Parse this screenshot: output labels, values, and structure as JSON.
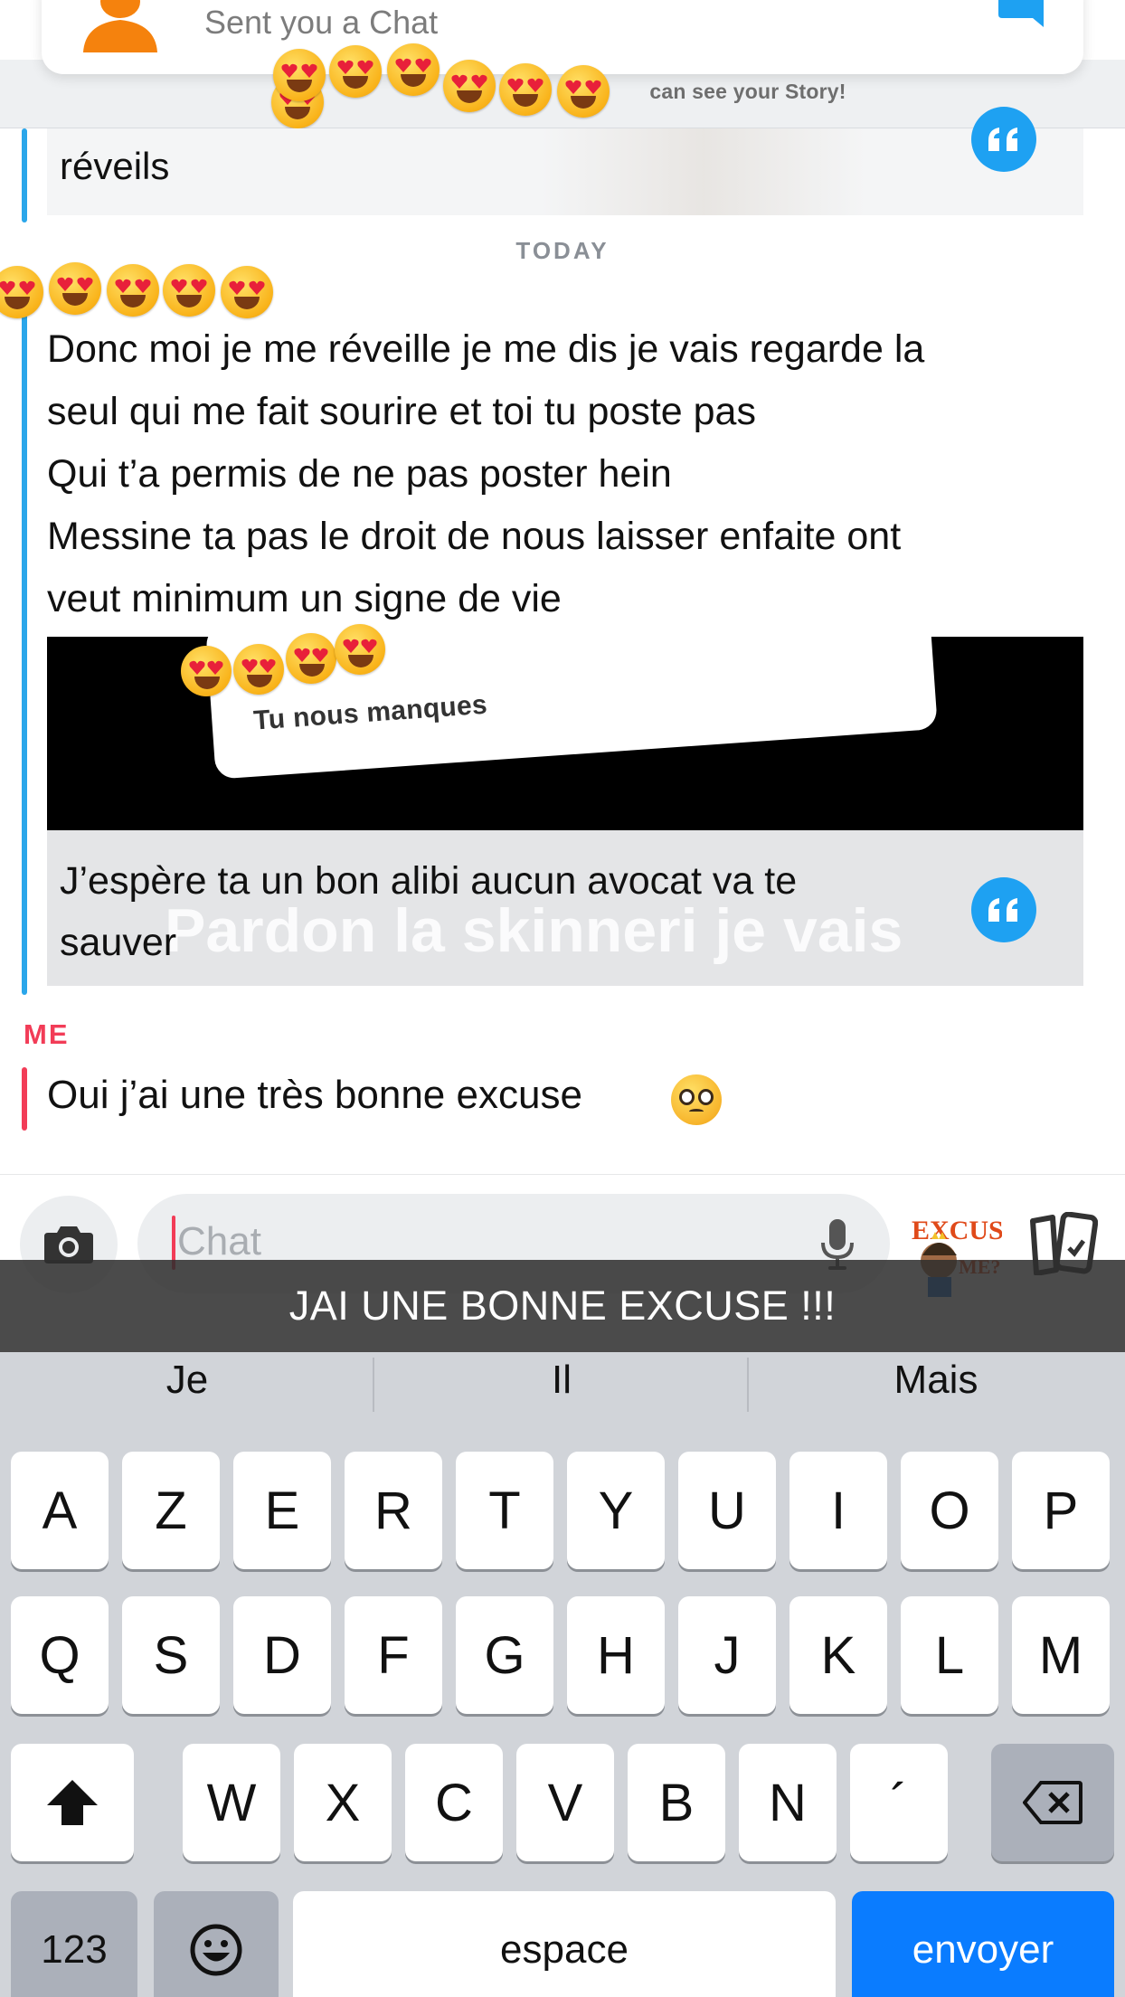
{
  "notification": {
    "text": "Sent you a Chat",
    "story_notice": "can see your Story!"
  },
  "conversation": {
    "quoted_story_text": "réveils",
    "day_separator": "TODAY",
    "incoming_message_lines": [
      "Donc moi je me réveille je me dis je vais regarde la",
      "seul qui me fait sourire et toi tu poste pas",
      "Qui t’a permis de ne pas poster hein",
      "Messine ta pas le droit de nous laisser enfaite ont",
      "veut minimum un signe de vie"
    ],
    "story_sticker_text": "Tu nous manques",
    "story_reply_lines": [
      "J’espère ta un bon alibi aucun avocat va te",
      "sauver"
    ],
    "story_overlay_text": "Pardon la skinneri je vais",
    "me_label": "ME",
    "my_message": "Oui j’ai une très bonne excuse"
  },
  "chat_input": {
    "placeholder": "Chat"
  },
  "caption": "JAI UNE BONNE EXCUSE !!!",
  "keyboard": {
    "suggestions": [
      "Je",
      "Il",
      "Mais"
    ],
    "row1": [
      "A",
      "Z",
      "E",
      "R",
      "T",
      "Y",
      "U",
      "I",
      "O",
      "P"
    ],
    "row2": [
      "Q",
      "S",
      "D",
      "F",
      "G",
      "H",
      "J",
      "K",
      "L",
      "M"
    ],
    "row3": [
      "W",
      "X",
      "C",
      "V",
      "B",
      "N",
      "´"
    ],
    "numbers_key": "123",
    "space_key": "espace",
    "send_key": "envoyer"
  },
  "colors": {
    "friend_accent": "#2aa6ea",
    "me_accent": "#f23c57",
    "send_key": "#0a7cff",
    "quote_button": "#1ea1f2"
  },
  "icons": [
    "avatar-icon",
    "chat-bubble-icon",
    "quote-icon",
    "camera-icon",
    "mic-icon",
    "bitmoji-sticker-icon",
    "sticker-icon",
    "shift-icon",
    "backspace-icon",
    "emoji-key-icon",
    "heart-eyes-emoji",
    "pleading-face-emoji"
  ]
}
